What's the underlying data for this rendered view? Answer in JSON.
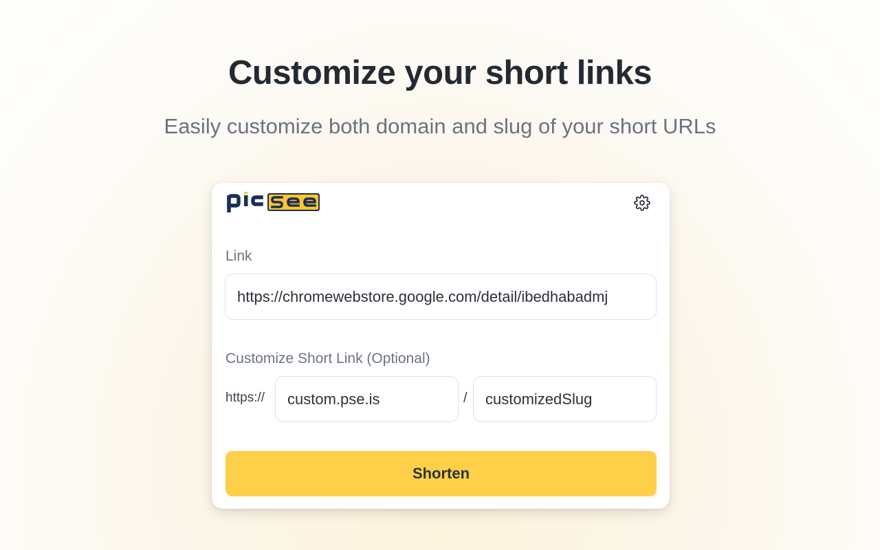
{
  "hero": {
    "title": "Customize your short links",
    "subtitle": "Easily customize both domain and slug of your short URLs"
  },
  "popup": {
    "logo_text": "picsee",
    "logo_icon": "picsee-logo",
    "settings_icon": "gear-icon",
    "link_label": "Link",
    "link_value": "https://chromewebstore.google.com/detail/ibedhabadmj",
    "custom_label": "Customize Short Link (Optional)",
    "scheme_prefix": "https://",
    "domain_value": "custom.pse.is",
    "separator": "/",
    "slug_value": "customizedSlug",
    "submit_label": "Shorten"
  },
  "colors": {
    "accent": "#fed049",
    "logo_navy": "#1a2f57",
    "logo_yellow": "#fec52e"
  }
}
